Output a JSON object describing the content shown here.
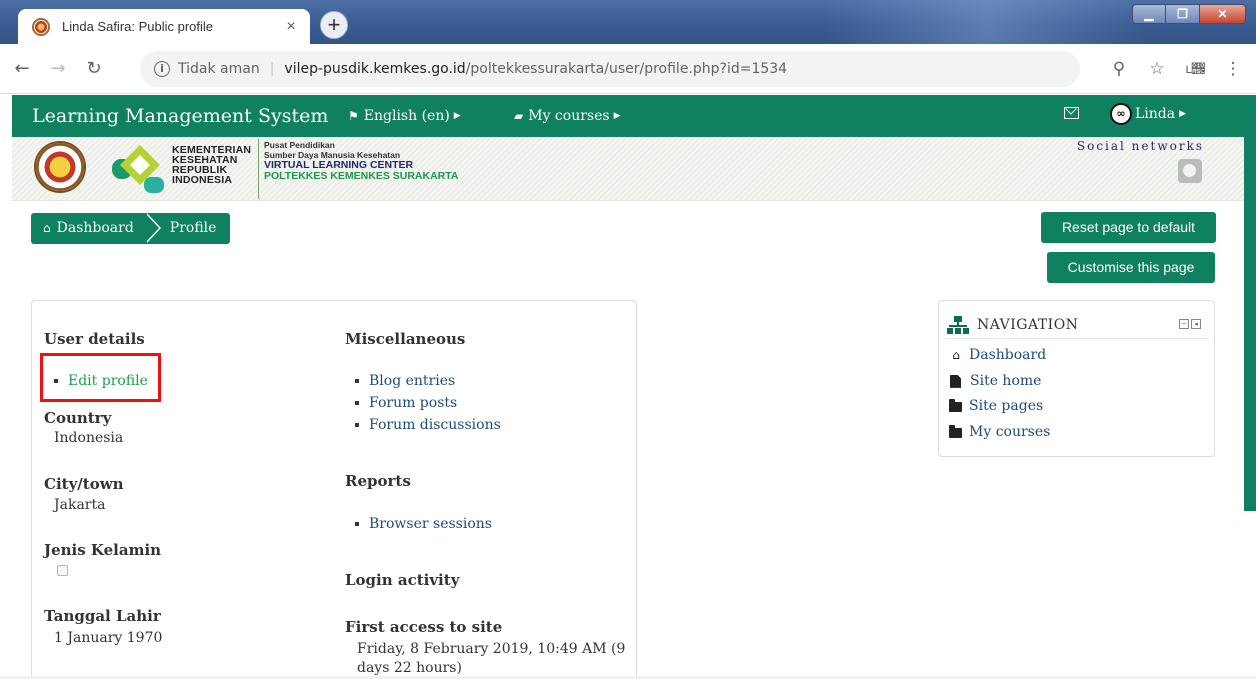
{
  "browser": {
    "tab_title": "Linda Safira: Public profile",
    "tab_close": "×",
    "new_tab": "+",
    "not_secure": "Tidak aman",
    "separator": "|",
    "url_host": "vilep-pusdik.kemkes.go.id",
    "url_path": "/poltekkessurakarta/user/profile.php?id=1534",
    "profile_avatar": "ʟ𐩜𐩝",
    "window_controls": [
      "minimize-icon",
      "maximize-icon",
      "close-icon"
    ]
  },
  "navbar": {
    "brand": "Learning Management System",
    "language": "English (en)",
    "my_courses": "My courses",
    "user_name": "Linda"
  },
  "banner": {
    "kementerian_lines": [
      "KEMENTERIAN",
      "KESEHATAN",
      "REPUBLIK",
      "INDONESIA"
    ],
    "org_lines": [
      "Pusat Pendidikan",
      "Sumber Daya Manusia Kesehatan",
      "VIRTUAL LEARNING CENTER",
      "POLTEKKES KEMENKES SURAKARTA"
    ],
    "social_networks": "Social networks"
  },
  "breadcrumb": {
    "dashboard": "Dashboard",
    "profile": "Profile"
  },
  "buttons": {
    "reset": "Reset page to default",
    "customise": "Customise this page"
  },
  "user_details": {
    "title": "User details",
    "edit_profile": "Edit profile",
    "country_label": "Country",
    "country_value": "Indonesia",
    "city_label": "City/town",
    "city_value": "Jakarta",
    "gender_label": "Jenis Kelamin",
    "dob_label": "Tanggal Lahir",
    "dob_value": "1 January 1970"
  },
  "miscellaneous": {
    "title": "Miscellaneous",
    "items": [
      "Blog entries",
      "Forum posts",
      "Forum discussions"
    ]
  },
  "reports": {
    "title": "Reports",
    "items": [
      "Browser sessions"
    ]
  },
  "login_activity": {
    "title": "Login activity",
    "first_access_label": "First access to site",
    "first_access_value": "Friday, 8 February 2019, 10:49 AM  (9",
    "first_access_value2": "days 22 hours)"
  },
  "navigation_block": {
    "title": "NAVIGATION",
    "items": [
      "Dashboard",
      "Site home",
      "Site pages",
      "My courses"
    ]
  },
  "colors": {
    "brand_green": "#0f8060",
    "link_blue": "#1d4c79",
    "edit_link_green": "#1ea04a",
    "highlight_red": "#ee1111"
  }
}
